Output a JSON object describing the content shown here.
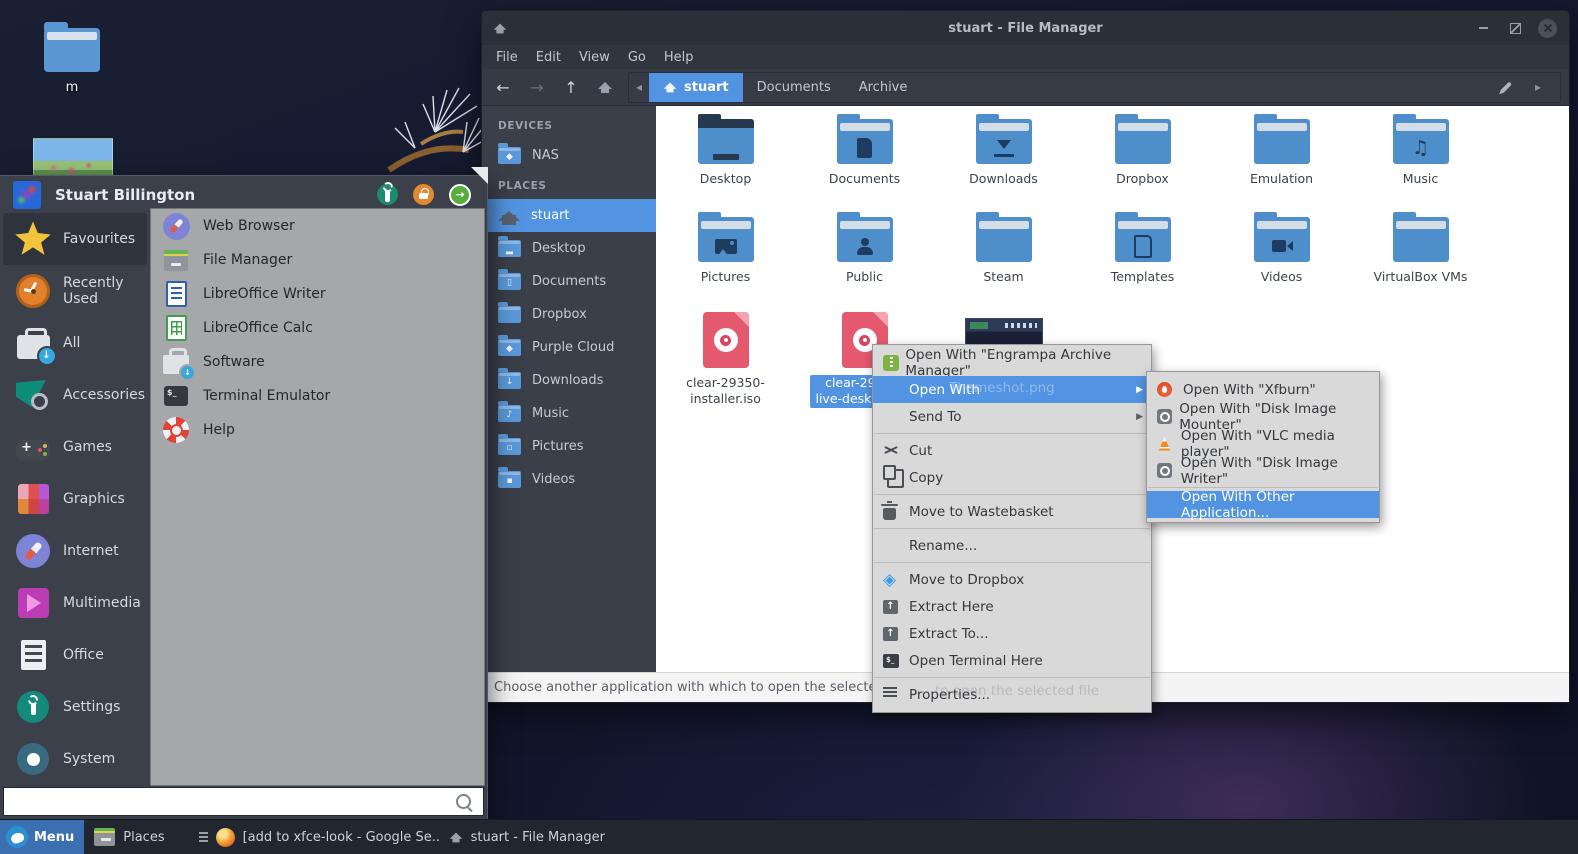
{
  "desktop": {
    "folder_label": "m"
  },
  "window": {
    "title": "stuart - File Manager",
    "menubar": [
      "File",
      "Edit",
      "View",
      "Go",
      "Help"
    ],
    "breadcrumbs": [
      {
        "label": "stuart",
        "active": true
      },
      {
        "label": "Documents",
        "active": false
      },
      {
        "label": "Archive",
        "active": false
      }
    ],
    "sidebar": {
      "devices_header": "DEVICES",
      "devices": [
        {
          "label": "NAS",
          "icon": "sfold",
          "glyph": "remote"
        }
      ],
      "places_header": "PLACES",
      "places": [
        {
          "label": "stuart",
          "icon": "home",
          "active": true
        },
        {
          "label": "Desktop",
          "icon": "sfold",
          "glyph": "desktop"
        },
        {
          "label": "Documents",
          "icon": "sfold",
          "glyph": "doc"
        },
        {
          "label": "Dropbox",
          "icon": "sfold",
          "glyph": "plain"
        },
        {
          "label": "Purple Cloud",
          "icon": "sfold",
          "glyph": "remote"
        },
        {
          "label": "Downloads",
          "icon": "sfold",
          "glyph": "dl"
        },
        {
          "label": "Music",
          "icon": "sfold",
          "glyph": "music"
        },
        {
          "label": "Pictures",
          "icon": "sfold",
          "glyph": "pic"
        },
        {
          "label": "Videos",
          "icon": "sfold",
          "glyph": "vid"
        }
      ]
    },
    "files": [
      {
        "label": "Desktop",
        "icon": "folder",
        "glyph": "desktop"
      },
      {
        "label": "Documents",
        "icon": "folder",
        "glyph": "doc"
      },
      {
        "label": "Downloads",
        "icon": "folder",
        "glyph": "dl"
      },
      {
        "label": "Dropbox",
        "icon": "folder",
        "glyph": "plain"
      },
      {
        "label": "Emulation",
        "icon": "folder",
        "glyph": "plain"
      },
      {
        "label": "Music",
        "icon": "folder",
        "glyph": "note"
      },
      {
        "label": "Pictures",
        "icon": "folder",
        "glyph": "photo"
      },
      {
        "label": "Public",
        "icon": "folder",
        "glyph": "person"
      },
      {
        "label": "Steam",
        "icon": "folder",
        "glyph": "plain"
      },
      {
        "label": "Templates",
        "icon": "folder",
        "glyph": "tpl"
      },
      {
        "label": "Videos",
        "icon": "folder",
        "glyph": "cam"
      },
      {
        "label": "VirtualBox VMs",
        "icon": "folder",
        "glyph": "plain"
      },
      {
        "label": "clear-29350-installer.iso",
        "icon": "iso"
      },
      {
        "label": "clear-29360-live-desktop.iso",
        "icon": "iso",
        "selected": true
      },
      {
        "label": "Themeshot.png",
        "icon": "thumb"
      }
    ],
    "statusbar": "Choose another application with which to open the selected file"
  },
  "context_menu": {
    "items": [
      {
        "icon": "engrampa",
        "label": "Open With \"Engrampa Archive Manager\""
      },
      {
        "icon": null,
        "label": "Open With",
        "submenu": true,
        "highlight": true
      },
      {
        "icon": null,
        "label": "Send To",
        "submenu": true
      },
      {
        "sep": true
      },
      {
        "icon": "cut",
        "label": "Cut"
      },
      {
        "icon": "copy",
        "label": "Copy"
      },
      {
        "sep": true
      },
      {
        "icon": "trash",
        "label": "Move to Wastebasket"
      },
      {
        "sep": true
      },
      {
        "icon": null,
        "label": "Rename..."
      },
      {
        "sep": true
      },
      {
        "icon": "dropbox",
        "label": "Move to Dropbox"
      },
      {
        "icon": "extract",
        "label": "Extract Here"
      },
      {
        "icon": "extract",
        "label": "Extract To..."
      },
      {
        "icon": "terminal",
        "label": "Open Terminal Here"
      },
      {
        "sep": true
      },
      {
        "icon": "props",
        "label": "Properties..."
      }
    ],
    "ghost_label_1": "Themeshot.png",
    "ghost_label_2": "to open the selected file"
  },
  "submenu": {
    "items": [
      {
        "icon": "xfburn",
        "label": "Open With \"Xfburn\""
      },
      {
        "icon": "disk",
        "label": "Open With \"Disk Image Mounter\""
      },
      {
        "icon": "vlc",
        "label": "Open With \"VLC media player\""
      },
      {
        "icon": "disk",
        "label": "Open With \"Disk Image Writer\""
      },
      {
        "sep": true
      },
      {
        "icon": null,
        "label": "Open With Other Application...",
        "highlight": true
      }
    ]
  },
  "whisker": {
    "user": "Stuart Billington",
    "categories": [
      {
        "label": "Favourites",
        "icon": "star",
        "selected": true
      },
      {
        "label": "Recently Used",
        "icon": "clock"
      },
      {
        "label": "All",
        "icon": "all"
      },
      {
        "label": "Accessories",
        "icon": "accessories"
      },
      {
        "label": "Games",
        "icon": "games"
      },
      {
        "label": "Graphics",
        "icon": "graphics"
      },
      {
        "label": "Internet",
        "icon": "internet"
      },
      {
        "label": "Multimedia",
        "icon": "multimedia"
      },
      {
        "label": "Office",
        "icon": "office"
      },
      {
        "label": "Settings",
        "icon": "settings"
      },
      {
        "label": "System",
        "icon": "system"
      }
    ],
    "apps": [
      {
        "label": "Web Browser",
        "icon": "browser"
      },
      {
        "label": "File Manager",
        "icon": "filemgr"
      },
      {
        "label": "LibreOffice Writer",
        "icon": "writer"
      },
      {
        "label": "LibreOffice Calc",
        "icon": "calc"
      },
      {
        "label": "Software",
        "icon": "software"
      },
      {
        "label": "Terminal Emulator",
        "icon": "terminalapp"
      },
      {
        "label": "Help",
        "icon": "help"
      }
    ],
    "search_value": ""
  },
  "taskbar": {
    "menu_label": "Menu",
    "places_label": "Places",
    "tasks": [
      {
        "icons": [
          "lines",
          "firefox"
        ],
        "label": "[add to xfce-look - Google Se..."
      },
      {
        "icons": [
          "taskhouse"
        ],
        "label": "stuart - File Manager"
      }
    ]
  }
}
